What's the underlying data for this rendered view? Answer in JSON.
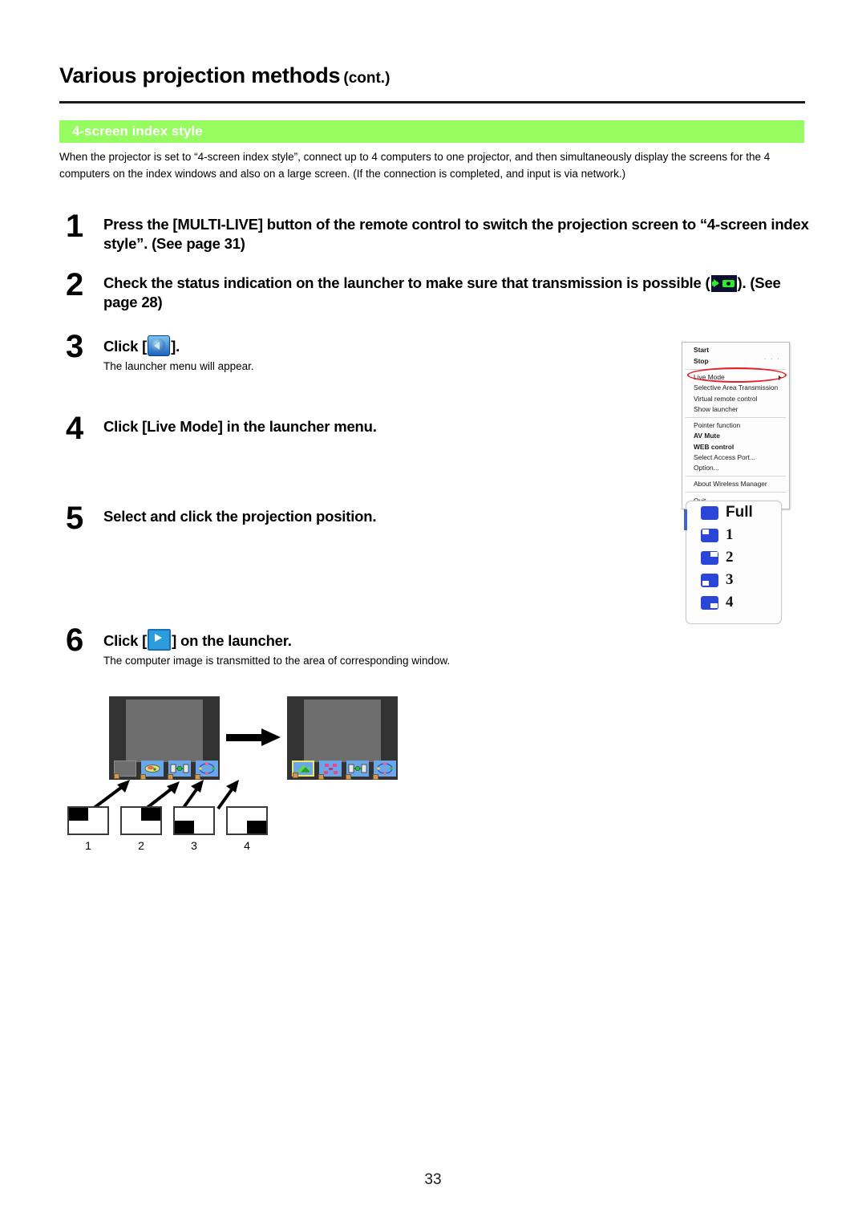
{
  "header": {
    "title": "Various projection methods",
    "title_suffix": "(cont.)"
  },
  "section": {
    "bar_label": "4-screen index style",
    "bar_color": "#97fc60",
    "intro": "When the projector is set to “4-screen index style”, connect up to 4 computers to one projector, and then simultaneously display the screens for the 4 computers on the index windows and also on a large screen. (If the connection is completed, and input is via network.)"
  },
  "steps": [
    {
      "number": "1",
      "title_before": "Press the [MULTI-LIVE] button of the remote control to switch the projection screen to “4-screen index style”. (See page 31)",
      "sub": ""
    },
    {
      "number": "2",
      "title_before": "Check the status indication on the launcher to make sure that transmission is possible (",
      "title_after": "). (See page 28)",
      "icon": "status-transmission-ready-icon",
      "sub": ""
    },
    {
      "number": "3",
      "title_before": "Click [",
      "title_after": "].",
      "icon": "launcher-expand-icon",
      "sub": "The launcher menu will appear."
    },
    {
      "number": "4",
      "title_before": "Click [Live Mode] in the launcher menu.",
      "sub": ""
    },
    {
      "number": "5",
      "title_before": "Select and click the projection position.",
      "sub": ""
    },
    {
      "number": "6",
      "title_before": "Click [",
      "title_after": "] on the launcher.",
      "icon": "launcher-transmit-play-icon",
      "sub": "The computer image is transmitted to the area of corresponding window."
    }
  ],
  "launcher_menu": {
    "items": [
      {
        "label": "Start",
        "bold": true,
        "separator_after": false,
        "arrow": false,
        "dots": false
      },
      {
        "label": "Stop",
        "bold": true,
        "separator_after": true,
        "arrow": false,
        "dots": true
      },
      {
        "label": "Live Mode",
        "bold": false,
        "separator_after": false,
        "arrow": true,
        "dots": false,
        "highlighted": true
      },
      {
        "label": "Selective Area Transmission",
        "bold": false,
        "separator_after": false,
        "arrow": false,
        "dots": false
      },
      {
        "label": "Virtual remote control",
        "bold": false,
        "separator_after": false,
        "arrow": false,
        "dots": false
      },
      {
        "label": "Show launcher",
        "bold": false,
        "separator_after": true,
        "arrow": false,
        "dots": false
      },
      {
        "label": "Pointer function",
        "bold": false,
        "separator_after": false,
        "arrow": false,
        "dots": false
      },
      {
        "label": "AV Mute",
        "bold": true,
        "separator_after": false,
        "arrow": false,
        "dots": false
      },
      {
        "label": "WEB control",
        "bold": true,
        "separator_after": false,
        "arrow": false,
        "dots": false
      },
      {
        "label": "Select Access Port...",
        "bold": false,
        "separator_after": false,
        "arrow": false,
        "dots": false
      },
      {
        "label": "Option...",
        "bold": false,
        "separator_after": true,
        "arrow": false,
        "dots": false
      },
      {
        "label": "About Wireless Manager",
        "bold": false,
        "separator_after": true,
        "arrow": false,
        "dots": false
      },
      {
        "label": "Quit",
        "bold": false,
        "separator_after": false,
        "arrow": false,
        "dots": false
      }
    ],
    "highlight_color": "#e8202a"
  },
  "position_panel": {
    "options": [
      {
        "label": "Full",
        "quadrant": "full"
      },
      {
        "label": "1",
        "quadrant": "top-left"
      },
      {
        "label": "2",
        "quadrant": "top-right"
      },
      {
        "label": "3",
        "quadrant": "bottom-left"
      },
      {
        "label": "4",
        "quadrant": "bottom-right"
      }
    ],
    "accent_color": "#2a46d8"
  },
  "diagram": {
    "quadrant_labels": [
      "1",
      "2",
      "3",
      "4"
    ],
    "screen_before": {
      "thumbnails": [
        "empty",
        "image-a",
        "image-b",
        "image-c"
      ]
    },
    "screen_after": {
      "thumbnails": [
        "image-new-selected",
        "image-a",
        "image-b",
        "image-c"
      ]
    }
  },
  "footer": {
    "page_number": "33"
  }
}
